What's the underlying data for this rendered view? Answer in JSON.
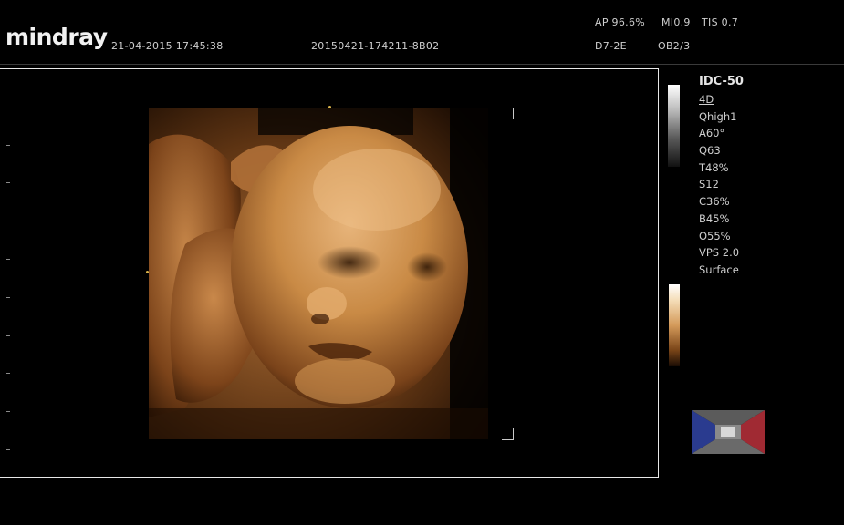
{
  "header": {
    "brand": "mindray",
    "datetime": "21-04-2015 17:45:38",
    "exam_id": "20150421-174211-8B02",
    "power": "AP 96.6%",
    "mechanical_index": "MI0.9",
    "thermal_index": "TIS 0.7",
    "probe": "D7-2E",
    "preset": "OB2/3"
  },
  "panel": {
    "title": "IDC-50",
    "items": [
      "4D",
      "Qhigh1",
      "A60°",
      "Q63",
      "T48%",
      "S12",
      "C36%",
      "B45%",
      "O55%",
      "VPS 2.0",
      "Surface"
    ]
  },
  "colors": {
    "background": "#000000",
    "text": "#cfcfcf",
    "frame": "#e8e8e8",
    "render_tone": "#c98a45",
    "orient_left": "#2a3b8f",
    "orient_right": "#a02a33"
  }
}
